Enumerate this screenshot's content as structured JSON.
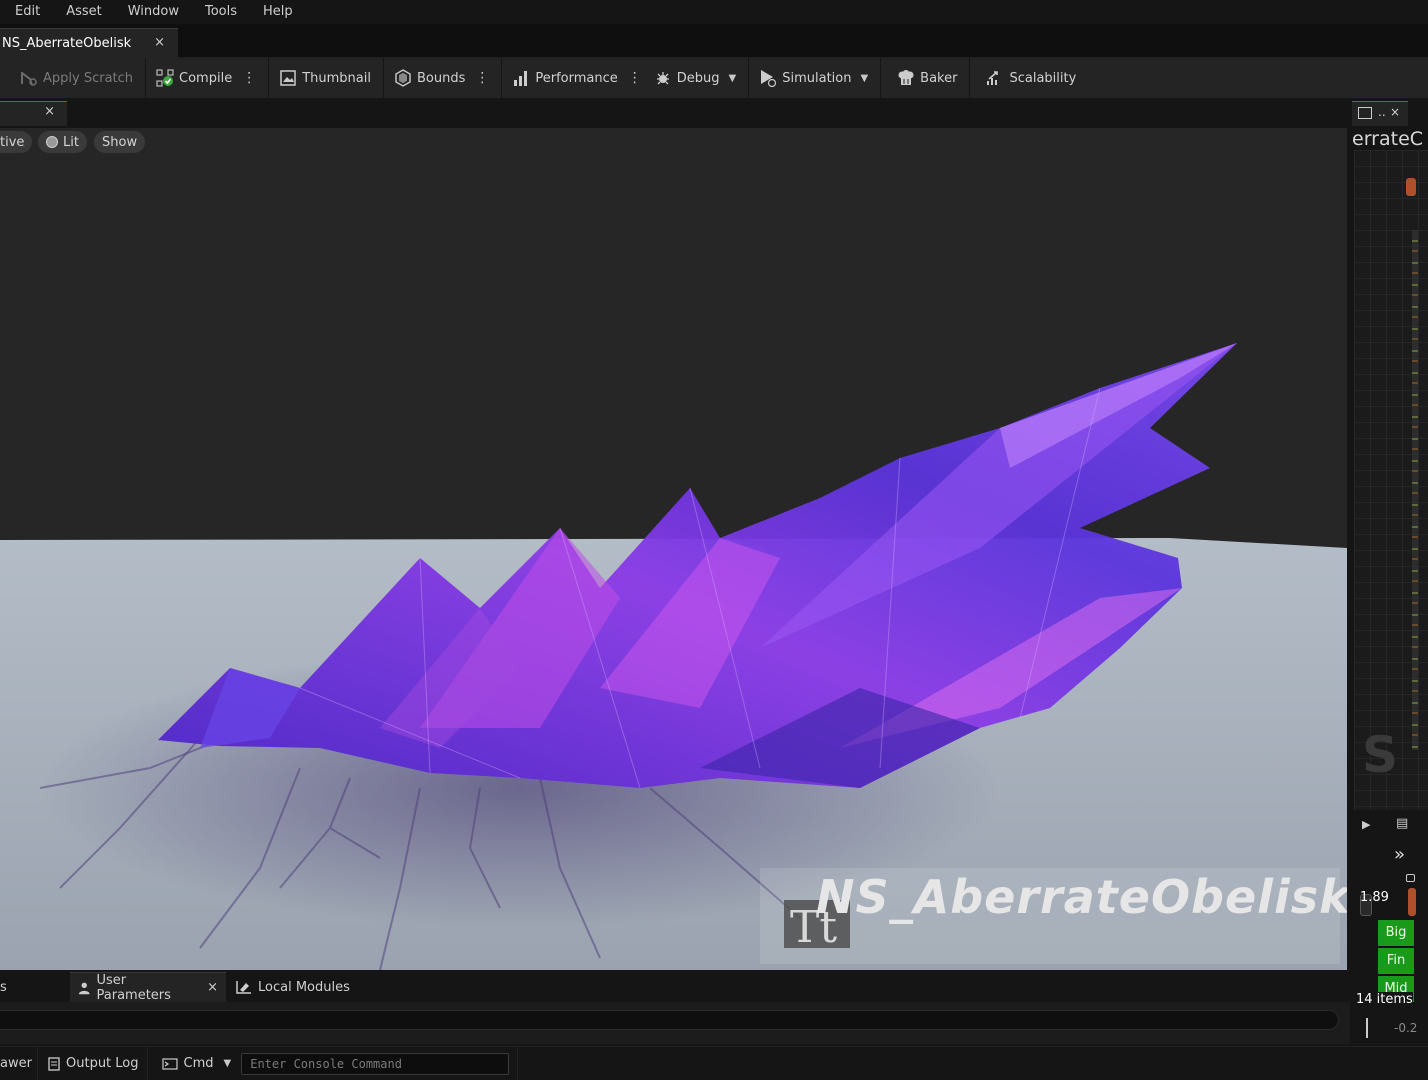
{
  "menu": [
    "Edit",
    "Asset",
    "Window",
    "Tools",
    "Help"
  ],
  "document_tab": {
    "title": "NS_AberrateObelisk",
    "close": "×"
  },
  "toolbar": {
    "apply_scratch": "Apply Scratch",
    "compile": "Compile",
    "thumbnail": "Thumbnail",
    "bounds": "Bounds",
    "performance": "Performance",
    "debug": "Debug",
    "simulation": "Simulation",
    "baker": "Baker",
    "scalability": "Scalability"
  },
  "viewport_tab": {
    "close": "×"
  },
  "viewport": {
    "chips": {
      "perspective": "tive",
      "lit": "Lit",
      "show": "Show"
    },
    "asset_label": "NS_AberrateObelisk",
    "colors": {
      "crystal": "#7a3cf0",
      "crystal_highlight": "#d65cf0",
      "floor": "#a9b1bd",
      "background": "#262626"
    }
  },
  "right_panel": {
    "tab_close": "×",
    "title": "errateC",
    "watermark": "S",
    "value": "1.89",
    "emitters": [
      "Big",
      "Fin",
      "Mid"
    ],
    "items_count": "14 items",
    "neg_value": "-0.2"
  },
  "bottom_tabs": {
    "first": "s",
    "user_parameters": "User Parameters",
    "local_modules": "Local Modules",
    "close": "×"
  },
  "statusbar": {
    "drawer": "awer",
    "output_log": "Output Log",
    "cmd": "Cmd",
    "console_placeholder": "Enter Console Command"
  }
}
